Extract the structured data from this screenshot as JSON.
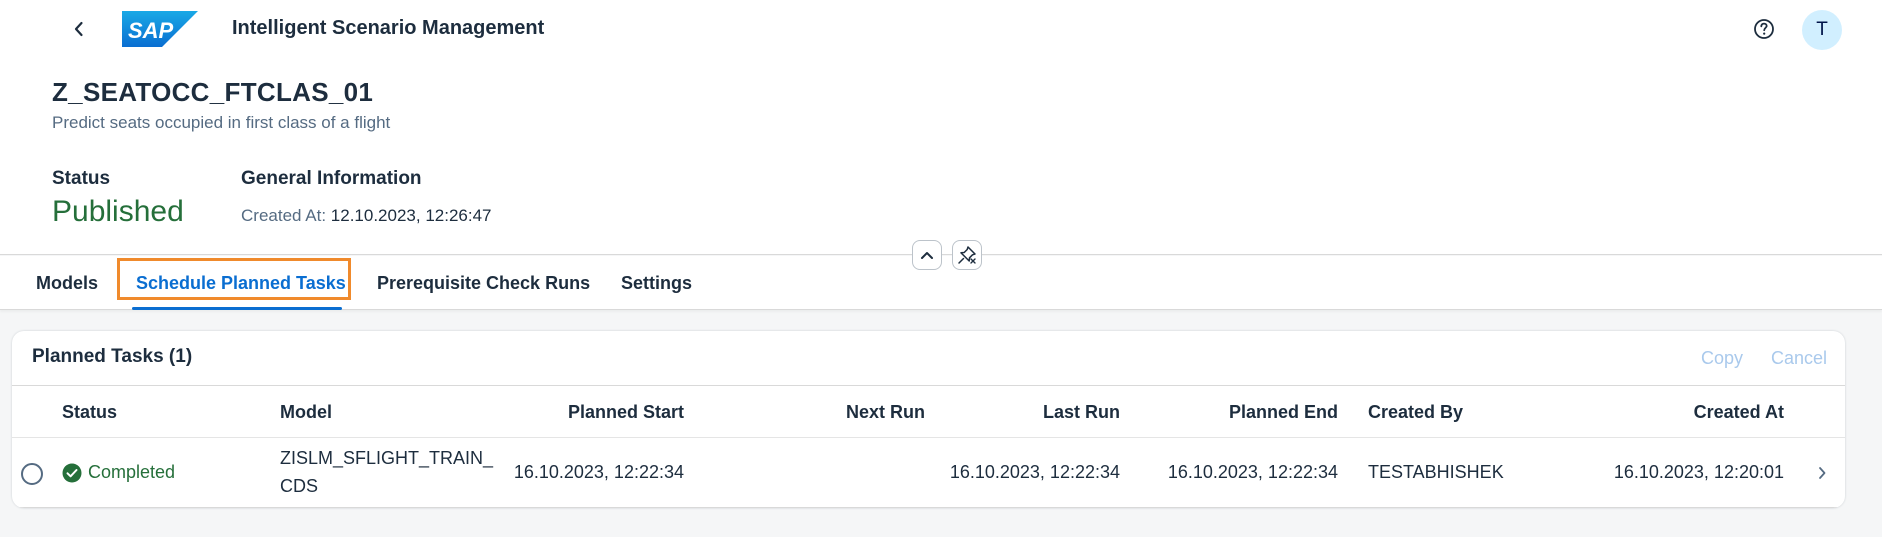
{
  "shell": {
    "logo_text": "SAP",
    "app_title": "Intelligent Scenario Management",
    "avatar_initial": "T"
  },
  "object": {
    "title": "Z_SEATOCC_FTCLAS_01",
    "subtitle": "Predict seats occupied in first class of a flight",
    "status_label": "Status",
    "status_value": "Published",
    "general_info_label": "General Information",
    "created_at_label": "Created At:",
    "created_at_value": "12.10.2023, 12:26:47"
  },
  "tabs": [
    {
      "label": "Models"
    },
    {
      "label": "Schedule Planned Tasks",
      "active": true
    },
    {
      "label": "Prerequisite Check Runs"
    },
    {
      "label": "Settings"
    }
  ],
  "planned_tasks": {
    "title": "Planned Tasks (1)",
    "actions": {
      "copy": "Copy",
      "cancel": "Cancel"
    },
    "columns": {
      "status": "Status",
      "model": "Model",
      "planned_start": "Planned Start",
      "next_run": "Next Run",
      "last_run": "Last Run",
      "planned_end": "Planned End",
      "created_by": "Created By",
      "created_at": "Created At"
    },
    "rows": [
      {
        "status": "Completed",
        "model_line1": "ZISLM_SFLIGHT_TRAIN_",
        "model_line2": "CDS",
        "planned_start": "16.10.2023, 12:22:34",
        "next_run": "",
        "last_run": "16.10.2023, 12:22:34",
        "planned_end": "16.10.2023, 12:22:34",
        "created_by": "TESTABHISHEK",
        "created_at": "16.10.2023, 12:20:01"
      }
    ]
  },
  "colors": {
    "accent": "#0a6ed1",
    "positive": "#256f3a",
    "focus_outline": "#f08a2c",
    "sap_blue": "#0a6ed1",
    "avatar_bg": "#d1efff"
  },
  "icons": {
    "back": "chevron-left-icon",
    "help": "question-mark-icon",
    "collapse": "chevron-up-icon",
    "pin": "unpin-icon",
    "status_ok": "checkmark-circle-icon",
    "navigate": "chevron-right-icon"
  }
}
